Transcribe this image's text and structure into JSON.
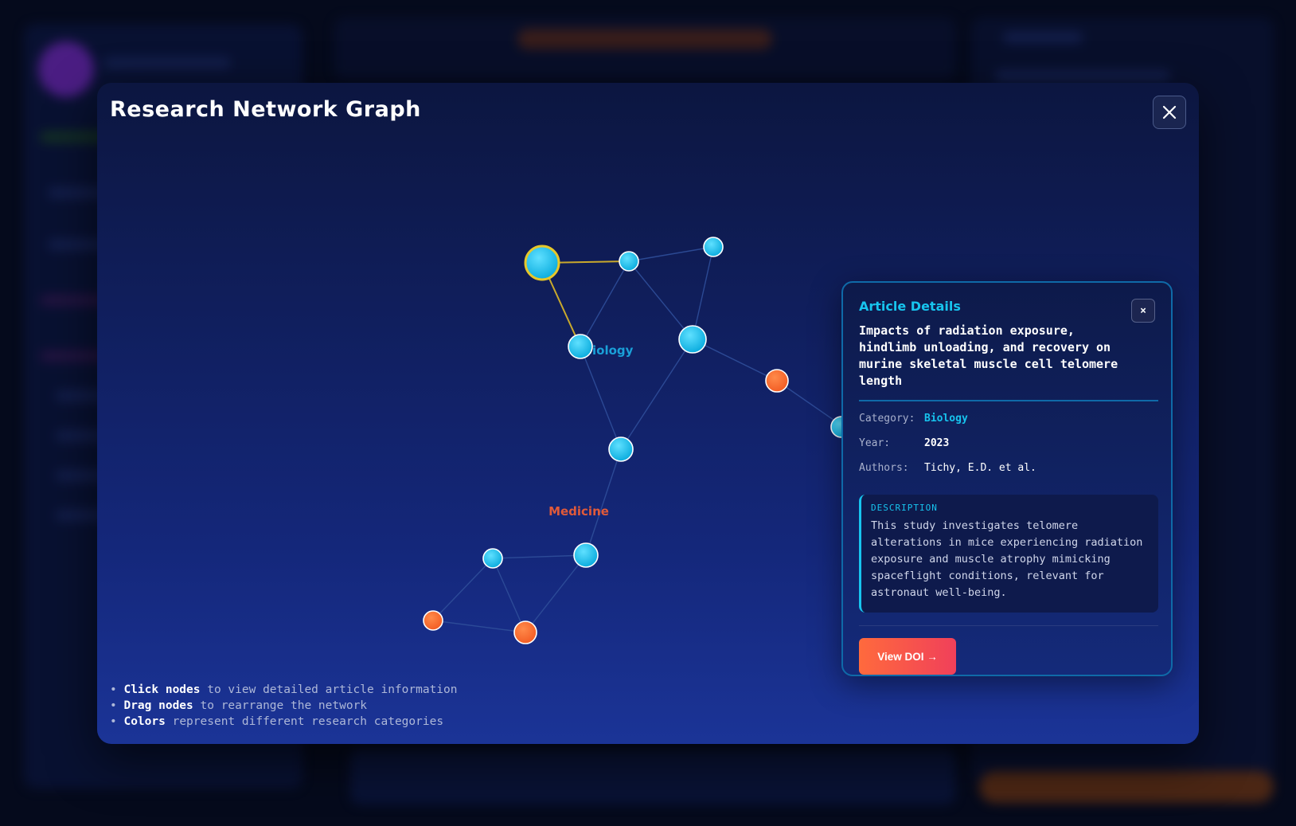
{
  "modal": {
    "title": "Research Network Graph",
    "close_label": "✕"
  },
  "graph": {
    "clusters": [
      {
        "label": "Biology",
        "color": "#1aa0d8"
      },
      {
        "label": "Medicine",
        "color": "#e05a3a"
      }
    ],
    "colors": {
      "biology": "#0fc6ef",
      "medicine": "#ff6a32",
      "selected_ring": "#e6c72a",
      "edge": "#2f4e9a",
      "selected_edge": "#c9a92c"
    }
  },
  "hints": [
    {
      "bold": "Click nodes",
      "rest": " to view detailed article information"
    },
    {
      "bold": "Drag nodes",
      "rest": " to rearrange the network"
    },
    {
      "bold": "Colors",
      "rest": " represent different research categories"
    }
  ],
  "details": {
    "heading": "Article Details",
    "close_label": "×",
    "article_title": "Impacts of radiation exposure, hindlimb unloading, and recovery on murine skeletal muscle cell telomere length",
    "category_label": "Category:",
    "category_value": "Biology",
    "year_label": "Year:",
    "year_value": "2023",
    "authors_label": "Authors:",
    "authors_value": "Tichy, E.D. et al.",
    "description_label": "DESCRIPTION",
    "description_text": "This study investigates telomere alterations in mice experiencing radiation exposure and muscle atrophy mimicking spaceflight conditions, relevant for astronaut well-being.",
    "doi_button": "View DOI →"
  }
}
